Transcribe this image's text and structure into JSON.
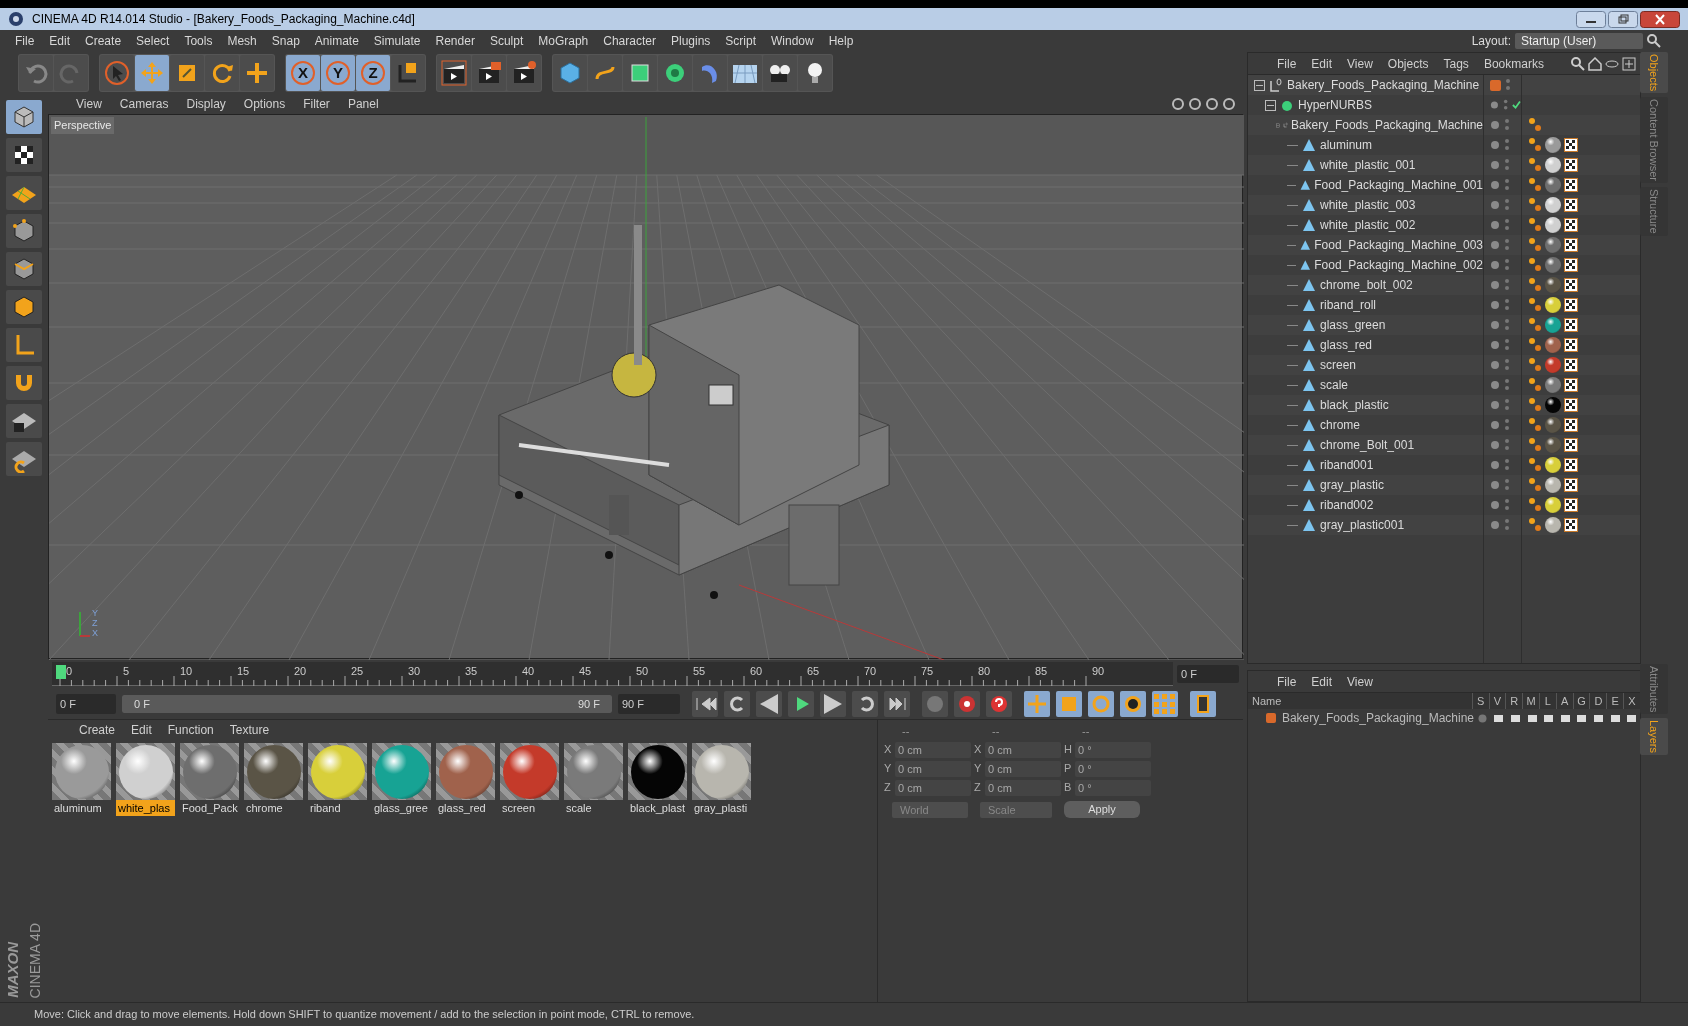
{
  "window": {
    "title": "CINEMA 4D R14.014 Studio - [Bakery_Foods_Packaging_Machine.c4d]"
  },
  "menu": [
    "File",
    "Edit",
    "Create",
    "Select",
    "Tools",
    "Mesh",
    "Snap",
    "Animate",
    "Simulate",
    "Render",
    "Sculpt",
    "MoGraph",
    "Character",
    "Plugins",
    "Script",
    "Window",
    "Help"
  ],
  "layout": {
    "label": "Layout:",
    "value": "Startup (User)"
  },
  "toolbar": [
    {
      "kind": "undo",
      "selected": false
    },
    {
      "kind": "redo",
      "selected": false
    },
    {
      "kind": "select",
      "selected": false
    },
    {
      "kind": "move",
      "selected": true
    },
    {
      "kind": "scale",
      "selected": false
    },
    {
      "kind": "rotate",
      "selected": false
    },
    {
      "kind": "add",
      "selected": false
    },
    {
      "kind": "axis",
      "label": "X",
      "selected": true
    },
    {
      "kind": "axis",
      "label": "Y",
      "selected": true
    },
    {
      "kind": "axis",
      "label": "Z",
      "selected": true
    },
    {
      "kind": "coords",
      "selected": false
    },
    {
      "kind": "render_view",
      "selected": false
    },
    {
      "kind": "render",
      "selected": false
    },
    {
      "kind": "render_settings",
      "selected": false
    },
    {
      "kind": "cube",
      "selected": false
    },
    {
      "kind": "spline",
      "selected": false
    },
    {
      "kind": "nurbs",
      "selected": false
    },
    {
      "kind": "array",
      "selected": false
    },
    {
      "kind": "deformer",
      "selected": false
    },
    {
      "kind": "floor",
      "selected": false
    },
    {
      "kind": "camera",
      "selected": false
    },
    {
      "kind": "light",
      "selected": false
    }
  ],
  "left_tools": [
    {
      "kind": "model",
      "selected": true
    },
    {
      "kind": "texture",
      "selected": false
    },
    {
      "kind": "workplane",
      "selected": false
    },
    {
      "kind": "points",
      "selected": false
    },
    {
      "kind": "edges",
      "selected": false
    },
    {
      "kind": "polygons",
      "selected": false
    },
    {
      "kind": "axis",
      "selected": false
    },
    {
      "kind": "magnet",
      "selected": false
    },
    {
      "kind": "lock",
      "selected": false
    },
    {
      "kind": "snap",
      "selected": false
    }
  ],
  "viewport": {
    "menu": [
      "View",
      "Cameras",
      "Display",
      "Options",
      "Filter",
      "Panel"
    ],
    "camera": "Perspective",
    "gizmo_labels": [
      "Y",
      "Z",
      "X"
    ]
  },
  "timeline": {
    "ticks": [
      "0",
      "5",
      "10",
      "15",
      "20",
      "25",
      "30",
      "35",
      "40",
      "45",
      "50",
      "55",
      "60",
      "65",
      "70",
      "75",
      "80",
      "85",
      "90"
    ],
    "current_frame": "0 F"
  },
  "transport": {
    "start": "0 F",
    "range": {
      "start": "0 F",
      "end": "90 F",
      "level": 1
    },
    "end": "90 F"
  },
  "materials": {
    "menu": [
      "Create",
      "Edit",
      "Function",
      "Texture"
    ],
    "items": [
      {
        "name": "aluminum",
        "selected": false,
        "color": "#9a9a9a"
      },
      {
        "name": "white_plas",
        "selected": true,
        "color": "#d0d0d0"
      },
      {
        "name": "Food_Pack",
        "selected": false,
        "color": "#6e6e6e"
      },
      {
        "name": "chrome",
        "selected": false,
        "color": "#5a5446"
      },
      {
        "name": "riband",
        "selected": false,
        "color": "#d8cf3a"
      },
      {
        "name": "glass_gree",
        "selected": false,
        "color": "#17a394"
      },
      {
        "name": "glass_red",
        "selected": false,
        "color": "#a0624c"
      },
      {
        "name": "screen",
        "selected": false,
        "color": "#c43a2a"
      },
      {
        "name": "scale",
        "selected": false,
        "color": "#7a7a7a"
      },
      {
        "name": "black_plast",
        "selected": false,
        "color": "#050505"
      },
      {
        "name": "gray_plasti",
        "selected": false,
        "color": "#b8b6ae"
      }
    ]
  },
  "coordinates": {
    "headers": [
      "--",
      "--",
      "--"
    ],
    "rows": [
      {
        "cells": [
          {
            "axis": "X",
            "value": "0 cm"
          },
          {
            "axis": "X",
            "value": "0 cm"
          },
          {
            "axis": "H",
            "value": "0 °"
          }
        ]
      },
      {
        "cells": [
          {
            "axis": "Y",
            "value": "0 cm"
          },
          {
            "axis": "Y",
            "value": "0 cm"
          },
          {
            "axis": "P",
            "value": "0 °"
          }
        ]
      },
      {
        "cells": [
          {
            "axis": "Z",
            "value": "0 cm"
          },
          {
            "axis": "Z",
            "value": "0 cm"
          },
          {
            "axis": "B",
            "value": "0 °"
          }
        ]
      }
    ],
    "mode": "World",
    "transform": "Scale",
    "apply": "Apply"
  },
  "objects": {
    "menu": [
      "File",
      "Edit",
      "View",
      "Objects",
      "Tags",
      "Bookmarks"
    ],
    "tree": [
      {
        "name": "Bakery_Foods_Packaging_Machine",
        "kind": "null",
        "expanded": true,
        "layer": {
          "color": "#d9692b"
        },
        "children": [
          {
            "name": "HyperNURBS",
            "kind": "nurbs",
            "expanded": true,
            "enabled": true,
            "children": [
              {
                "name": "Bakery_Foods_Packaging_Machine",
                "kind": "null",
                "expanded": true,
                "children": [
                  {
                    "name": "aluminum",
                    "kind": "polygon",
                    "color": "#9a9a9a"
                  },
                  {
                    "name": "white_plastic_001",
                    "kind": "polygon",
                    "color": "#d0d0d0"
                  },
                  {
                    "name": "Food_Packaging_Machine_001",
                    "kind": "polygon",
                    "color": "#6e6e6e"
                  },
                  {
                    "name": "white_plastic_003",
                    "kind": "polygon",
                    "color": "#d0d0d0"
                  },
                  {
                    "name": "white_plastic_002",
                    "kind": "polygon",
                    "color": "#d0d0d0"
                  },
                  {
                    "name": "Food_Packaging_Machine_003",
                    "kind": "polygon",
                    "color": "#6e6e6e"
                  },
                  {
                    "name": "Food_Packaging_Machine_002",
                    "kind": "polygon",
                    "color": "#6e6e6e"
                  },
                  {
                    "name": "chrome_bolt_002",
                    "kind": "polygon",
                    "color": "#5a5446"
                  },
                  {
                    "name": "riband_roll",
                    "kind": "polygon",
                    "color": "#d8cf3a"
                  },
                  {
                    "name": "glass_green",
                    "kind": "polygon",
                    "color": "#17a394"
                  },
                  {
                    "name": "glass_red",
                    "kind": "polygon",
                    "color": "#a0624c"
                  },
                  {
                    "name": "screen",
                    "kind": "polygon",
                    "color": "#c43a2a"
                  },
                  {
                    "name": "scale",
                    "kind": "polygon",
                    "color": "#7a7a7a"
                  },
                  {
                    "name": "black_plastic",
                    "kind": "polygon",
                    "color": "#050505"
                  },
                  {
                    "name": "chrome",
                    "kind": "polygon",
                    "color": "#5a5446"
                  },
                  {
                    "name": "chrome_Bolt_001",
                    "kind": "polygon",
                    "color": "#5a5446"
                  },
                  {
                    "name": "riband001",
                    "kind": "polygon",
                    "color": "#d8cf3a"
                  },
                  {
                    "name": "gray_plastic",
                    "kind": "polygon",
                    "color": "#b8b6ae"
                  },
                  {
                    "name": "riband002",
                    "kind": "polygon",
                    "color": "#d8cf3a"
                  },
                  {
                    "name": "gray_plastic001",
                    "kind": "polygon",
                    "color": "#b8b6ae"
                  }
                ]
              }
            ]
          }
        ]
      }
    ]
  },
  "side_tabs_top": [
    {
      "label": "Objects",
      "selected": true
    },
    {
      "label": "Content Browser",
      "selected": false
    },
    {
      "label": "Structure",
      "selected": false
    }
  ],
  "layers": {
    "menu": [
      "File",
      "Edit",
      "View"
    ],
    "columns": [
      "Name",
      "S",
      "V",
      "R",
      "M",
      "L",
      "A",
      "G",
      "D",
      "E",
      "X"
    ],
    "rows": [
      {
        "name": "Bakery_Foods_Packaging_Machine",
        "color": "#d9692b"
      }
    ]
  },
  "side_tabs_bottom": [
    {
      "label": "Attributes",
      "selected": false
    },
    {
      "label": "Layers",
      "selected": true
    }
  ],
  "logo": [
    "MAXON",
    "CINEMA 4D"
  ],
  "status_bar": "Move: Click and drag to move elements. Hold down SHIFT to quantize movement / add to the selection in point mode, CTRL to remove."
}
